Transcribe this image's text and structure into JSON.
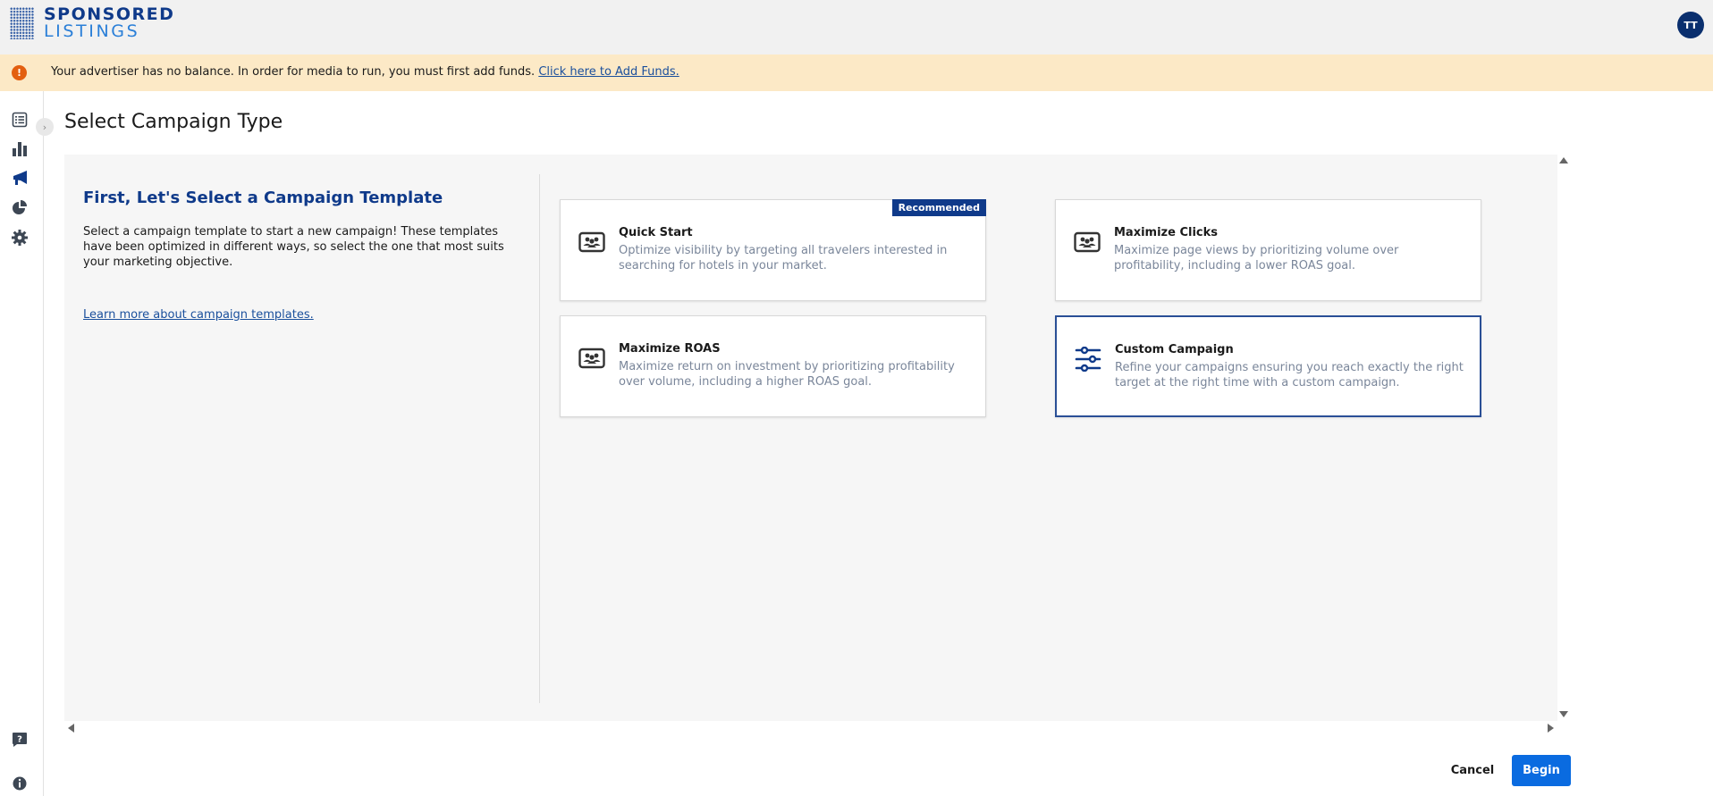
{
  "brand": {
    "line1": "SPONSORED",
    "line2": "LISTINGS"
  },
  "user": {
    "initials": "TT"
  },
  "alert": {
    "message": "Your advertiser has no balance. In order for media to run, you must first add funds.",
    "link_label": "Click here to Add Funds."
  },
  "nav": {
    "icons": [
      "list-icon",
      "bar-chart-icon",
      "megaphone-icon",
      "pie-chart-icon",
      "gear-icon",
      "help-icon",
      "info-icon"
    ],
    "toggle_glyph": "›"
  },
  "page": {
    "title": "Select Campaign Type"
  },
  "intro": {
    "title": "First, Let's Select a Campaign Template",
    "description": "Select a campaign template to start a new campaign! These templates have been optimized in different ways, so select the one that most suits your marketing objective.",
    "link_label": "Learn more about campaign templates."
  },
  "templates": [
    {
      "title": "Quick Start",
      "description": "Optimize visibility by targeting all travelers interested in searching for hotels in your market.",
      "badge": "Recommended",
      "icon": "people-card-icon",
      "selected": false
    },
    {
      "title": "Maximize Clicks",
      "description": "Maximize page views by prioritizing volume over profitability, including a lower ROAS goal.",
      "icon": "people-card-icon",
      "selected": false
    },
    {
      "title": "Maximize ROAS",
      "description": "Maximize return on investment by prioritizing profitability over volume, including a higher ROAS goal.",
      "icon": "people-card-icon",
      "selected": false
    },
    {
      "title": "Custom Campaign",
      "description": "Refine your campaigns ensuring you reach exactly the right target at the right time with a custom campaign.",
      "icon": "sliders-icon",
      "selected": true
    }
  ],
  "actions": {
    "cancel_label": "Cancel",
    "begin_label": "Begin"
  },
  "colors": {
    "brand_navy": "#0f3a8a",
    "accent_blue": "#0a6be0",
    "alert_bg": "#fce9c6",
    "alert_icon": "#e35f10"
  }
}
